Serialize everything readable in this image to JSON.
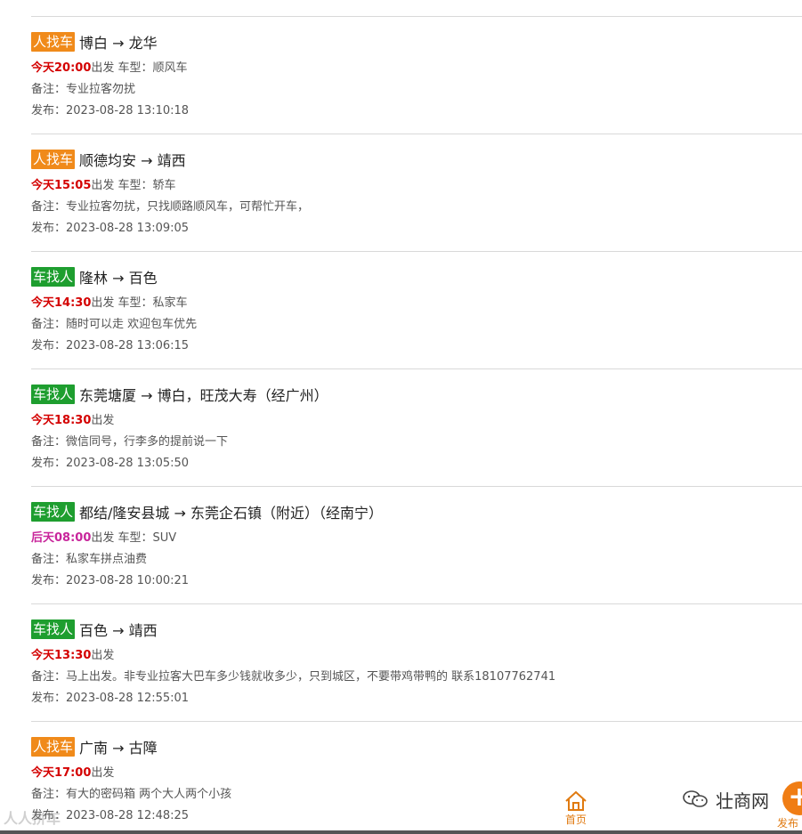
{
  "posts": [
    {
      "tag": "人找车",
      "tag_color": "orange",
      "route": "博白 → 龙华",
      "time": "今天20:00",
      "time_color": "red",
      "depart_suffix": "出发",
      "car_type": " 车型：顺风车",
      "note": "备注：专业拉客勿扰",
      "published": "发布：2023-08-28 13:10:18"
    },
    {
      "tag": "人找车",
      "tag_color": "orange",
      "route": "顺德均安 → 靖西",
      "time": "今天15:05",
      "time_color": "red",
      "depart_suffix": "出发",
      "car_type": " 车型：轿车",
      "note": "备注：专业拉客勿扰，只找顺路顺风车，可帮忙开车，",
      "published": "发布：2023-08-28 13:09:05"
    },
    {
      "tag": "车找人",
      "tag_color": "green",
      "route": "隆林 → 百色",
      "time": "今天14:30",
      "time_color": "red",
      "depart_suffix": "出发",
      "car_type": " 车型：私家车",
      "note": "备注：随时可以走 欢迎包车优先",
      "published": "发布：2023-08-28 13:06:15"
    },
    {
      "tag": "车找人",
      "tag_color": "green",
      "route": "东莞塘厦 → 博白，旺茂大寿（经广州）",
      "time": "今天18:30",
      "time_color": "red",
      "depart_suffix": "出发",
      "car_type": "",
      "note": "备注：微信同号，行李多的提前说一下",
      "published": "发布：2023-08-28 13:05:50"
    },
    {
      "tag": "车找人",
      "tag_color": "green",
      "route": "都结/隆安县城 → 东莞企石镇（附近）（经南宁）",
      "time": "后天08:00",
      "time_color": "magenta",
      "depart_suffix": "出发",
      "car_type": " 车型：SUV",
      "note": "备注：私家车拼点油费",
      "published": "发布：2023-08-28 10:00:21"
    },
    {
      "tag": "车找人",
      "tag_color": "green",
      "route": "百色 → 靖西",
      "time": "今天13:30",
      "time_color": "red",
      "depart_suffix": "出发",
      "car_type": "",
      "note": "备注：马上出发。非专业拉客大巴车多少钱就收多少，只到城区，不要带鸡带鸭的 联系18107762741",
      "published": "发布：2023-08-28 12:55:01"
    },
    {
      "tag": "人找车",
      "tag_color": "orange",
      "route": "广南 → 古障",
      "time": "今天17:00",
      "time_color": "red",
      "depart_suffix": "出发",
      "car_type": "",
      "note": "备注：有大的密码箱 两个大人两个小孩",
      "published": "发布：2023-08-28 12:48:25"
    }
  ],
  "nav": {
    "home_label": "首页",
    "home_icon": "home-icon",
    "publish_label": "发布",
    "publish_icon": "plus-icon"
  },
  "watermark": {
    "text": "壮商网",
    "icon": "wechat-icon"
  },
  "corner_watermark": "人人拼车",
  "colors": {
    "accent_orange": "#f08a1a",
    "tag_green": "#1e9e2f",
    "time_red": "#d40000",
    "time_magenta": "#c8259b"
  }
}
